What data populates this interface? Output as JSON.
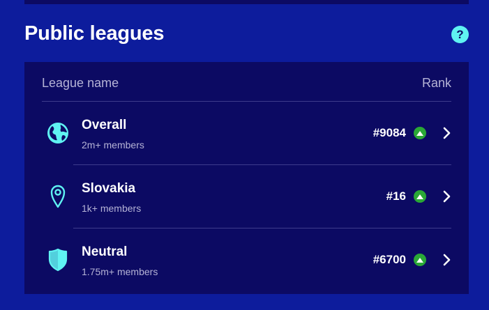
{
  "section": {
    "title": "Public leagues",
    "help_label": "?"
  },
  "table": {
    "col_name": "League name",
    "col_rank": "Rank"
  },
  "leagues": [
    {
      "name": "Overall",
      "members": "2m+ members",
      "rank": "#9084",
      "icon": "globe-icon",
      "movement": "up"
    },
    {
      "name": "Slovakia",
      "members": "1k+ members",
      "rank": "#16",
      "icon": "location-pin-icon",
      "movement": "up"
    },
    {
      "name": "Neutral",
      "members": "1.75m+ members",
      "rank": "#6700",
      "icon": "shield-icon",
      "movement": "up"
    }
  ],
  "colors": {
    "background": "#0d1c9c",
    "card": "#0c0a63",
    "accent": "#5ff2f2",
    "rank_up": "#2aa836"
  }
}
